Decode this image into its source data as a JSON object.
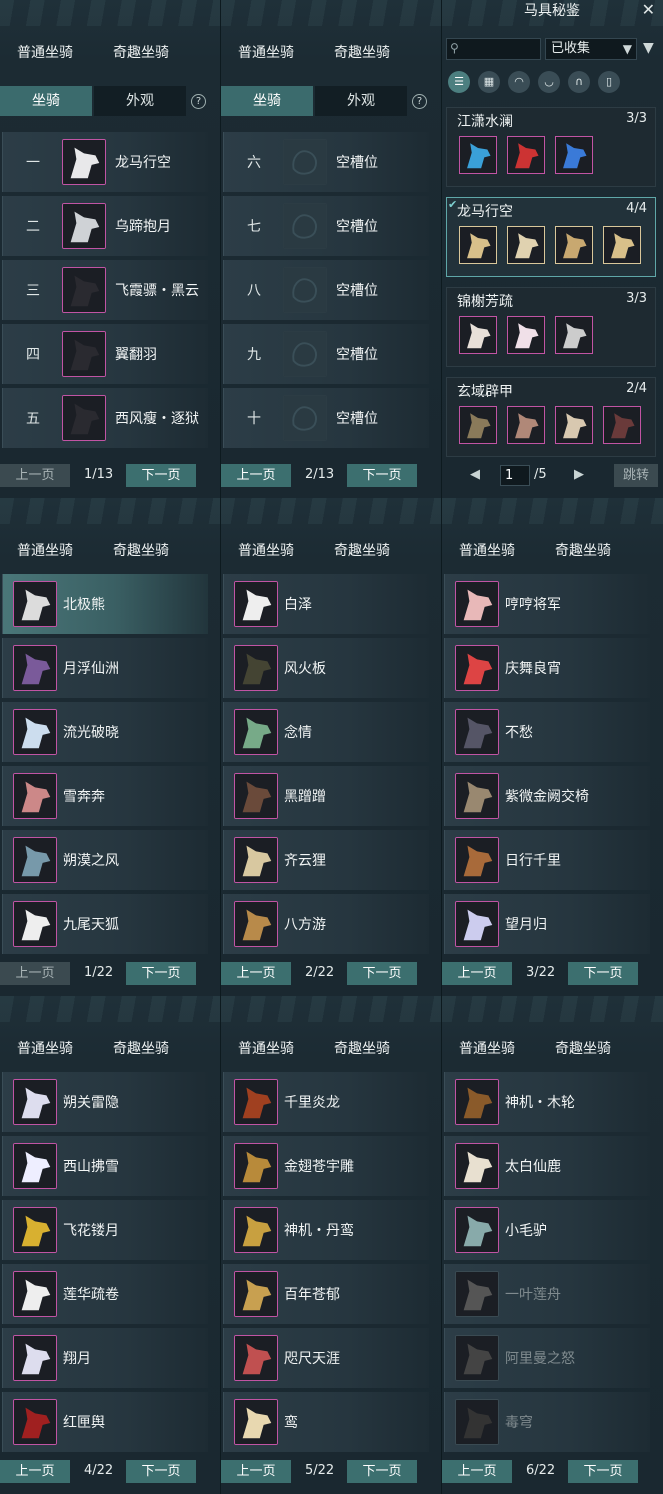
{
  "colors": {
    "accent": "#3c6f6f",
    "rare_border": "#c154a4",
    "selected_set_border": "#5fa7a8"
  },
  "tabs": {
    "normal": "普通坐骑",
    "fun": "奇趣坐骑",
    "mount": "坐骑",
    "appearance": "外观",
    "help": "?"
  },
  "pager": {
    "prev": "上一页",
    "next": "下一页"
  },
  "stable": [
    {
      "page": "1/13",
      "slots": [
        {
          "num": "一",
          "name": "龙马行空",
          "icon": "white-horse-icon"
        },
        {
          "num": "二",
          "name": "乌蹄抱月",
          "icon": "white-horse-icon"
        },
        {
          "num": "三",
          "name": "飞霞骠・黑云",
          "icon": "black-horse-icon"
        },
        {
          "num": "四",
          "name": "翼翻羽",
          "icon": "black-horse-icon"
        },
        {
          "num": "五",
          "name": "西风瘦・逐狱",
          "icon": "black-horse-icon"
        }
      ]
    },
    {
      "page": "2/13",
      "slots": [
        {
          "num": "六",
          "name": "空槽位",
          "icon": "empty-slot-icon"
        },
        {
          "num": "七",
          "name": "空槽位",
          "icon": "empty-slot-icon"
        },
        {
          "num": "八",
          "name": "空槽位",
          "icon": "empty-slot-icon"
        },
        {
          "num": "九",
          "name": "空槽位",
          "icon": "empty-slot-icon"
        },
        {
          "num": "十",
          "name": "空槽位",
          "icon": "empty-slot-icon"
        }
      ]
    }
  ],
  "codex": {
    "title": "马具秘鉴",
    "search_placeholder": "",
    "filter_value": "已收集",
    "filter_icons": [
      "list-icon",
      "grid-icon",
      "saddle-icon",
      "armor-icon",
      "horseshoe-icon",
      "bridle-icon"
    ],
    "sets": [
      {
        "name": "江潇水澜",
        "count": "3/3",
        "items": 3
      },
      {
        "name": "龙马行空",
        "count": "4/4",
        "items": 4
      },
      {
        "name": "锦榭芳疏",
        "count": "3/3",
        "items": 3
      },
      {
        "name": "玄域辟甲",
        "count": "2/4",
        "items": 4
      }
    ],
    "page_input": "1",
    "page_total": "/5",
    "jump": "跳转"
  },
  "fun_pages": [
    {
      "page": "1/22",
      "items": [
        "北极熊",
        "月浮仙洲",
        "流光破晓",
        "雪奔奔",
        "朔漠之风",
        "九尾天狐"
      ]
    },
    {
      "page": "2/22",
      "items": [
        "白泽",
        "风火板",
        "念情",
        "黑蹭蹭",
        "齐云狸",
        "八方游"
      ]
    },
    {
      "page": "3/22",
      "items": [
        "哼哼将军",
        "庆舞良宵",
        "不愁",
        "紫微金阙交椅",
        "日行千里",
        "望月归"
      ]
    },
    {
      "page": "4/22",
      "items": [
        "朔关雷隐",
        "西山拂雪",
        "飞花镂月",
        "莲华疏卷",
        "翔月",
        "红匣舆"
      ]
    },
    {
      "page": "5/22",
      "items": [
        "千里炎龙",
        "金翅苍宇雕",
        "神机・丹鸾",
        "百年苍郁",
        "咫尺天涯",
        "鸾"
      ]
    },
    {
      "page": "6/22",
      "items": [
        "神机・木轮",
        "太白仙鹿",
        "小毛驴",
        "一叶莲舟",
        "阿里曼之怒",
        "毒穹"
      ]
    }
  ]
}
